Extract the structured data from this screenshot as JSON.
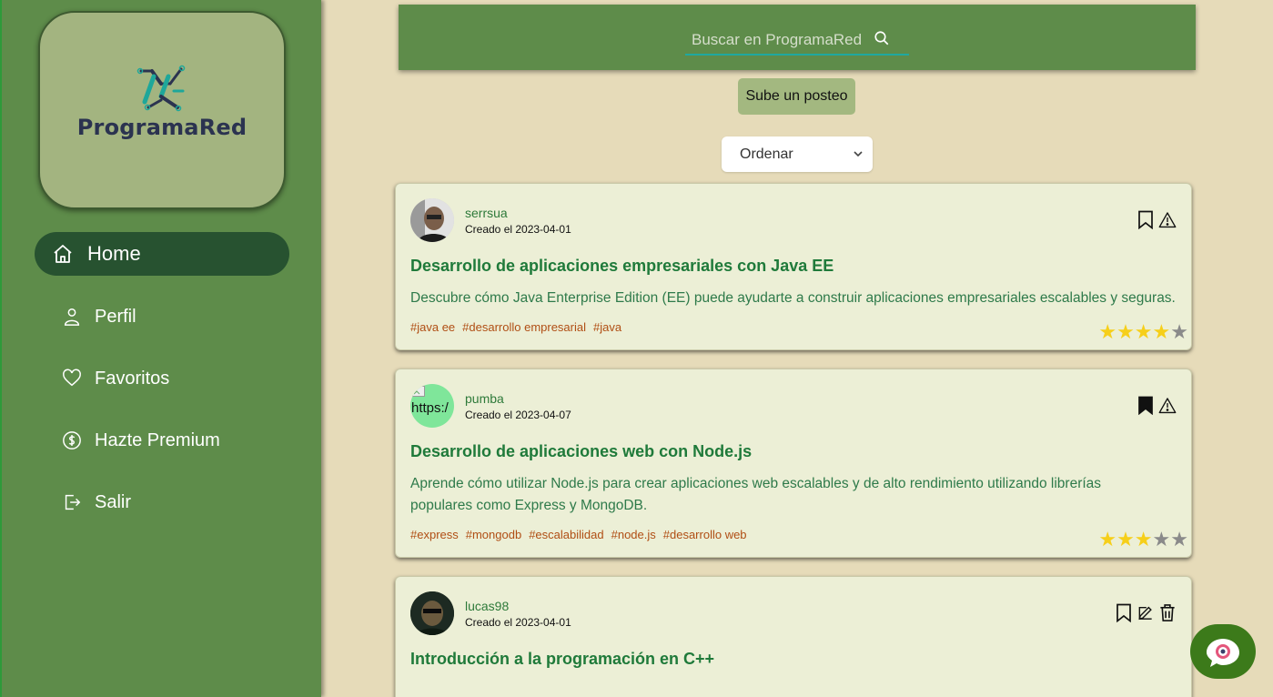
{
  "sidebar": {
    "logo_text": "ProgramaRed",
    "items": [
      {
        "label": "Home",
        "icon": "home-icon",
        "active": true
      },
      {
        "label": "Perfil",
        "icon": "user-icon",
        "active": false
      },
      {
        "label": "Favoritos",
        "icon": "heart-icon",
        "active": false
      },
      {
        "label": "Hazte Premium",
        "icon": "dollar-icon",
        "active": false
      },
      {
        "label": "Salir",
        "icon": "logout-icon",
        "active": false
      }
    ]
  },
  "search": {
    "placeholder": "Buscar en ProgramaRed"
  },
  "upload_button": "Sube un posteo",
  "order_select": "Ordenar",
  "posts": [
    {
      "author": "serrsua",
      "created": "Creado el 2023-04-01",
      "title": "Desarrollo de aplicaciones empresariales con Java EE",
      "description": "Descubre cómo Java Enterprise Edition (EE) puede ayudarte a construir aplicaciones empresariales escalables y seguras.",
      "tags": [
        "#java ee",
        "#desarrollo empresarial",
        "#java"
      ],
      "rating": 4,
      "bookmarked": false
    },
    {
      "author": "pumba",
      "created": "Creado el 2023-04-07",
      "avatar_alt": "https:/",
      "title": "Desarrollo de aplicaciones web con Node.js",
      "description": "Aprende cómo utilizar Node.js para crear aplicaciones web escalables y de alto rendimiento utilizando librerías populares como Express y MongoDB.",
      "tags": [
        "#express",
        "#mongodb",
        "#escalabilidad",
        "#node.js",
        "#desarrollo web"
      ],
      "rating": 3,
      "bookmarked": true
    },
    {
      "author": "lucas98",
      "created": "Creado el 2023-04-01",
      "title": "Introducción a la programación en C++"
    }
  ],
  "colors": {
    "sidebar": "#5e8c4a",
    "active_nav": "#275230",
    "background": "#e6dbb9",
    "card": "#ecefd6",
    "title": "#1f7a3a",
    "tag": "#b04e14",
    "star_on": "#f6cf1a",
    "star_off": "#8a8a8a"
  }
}
